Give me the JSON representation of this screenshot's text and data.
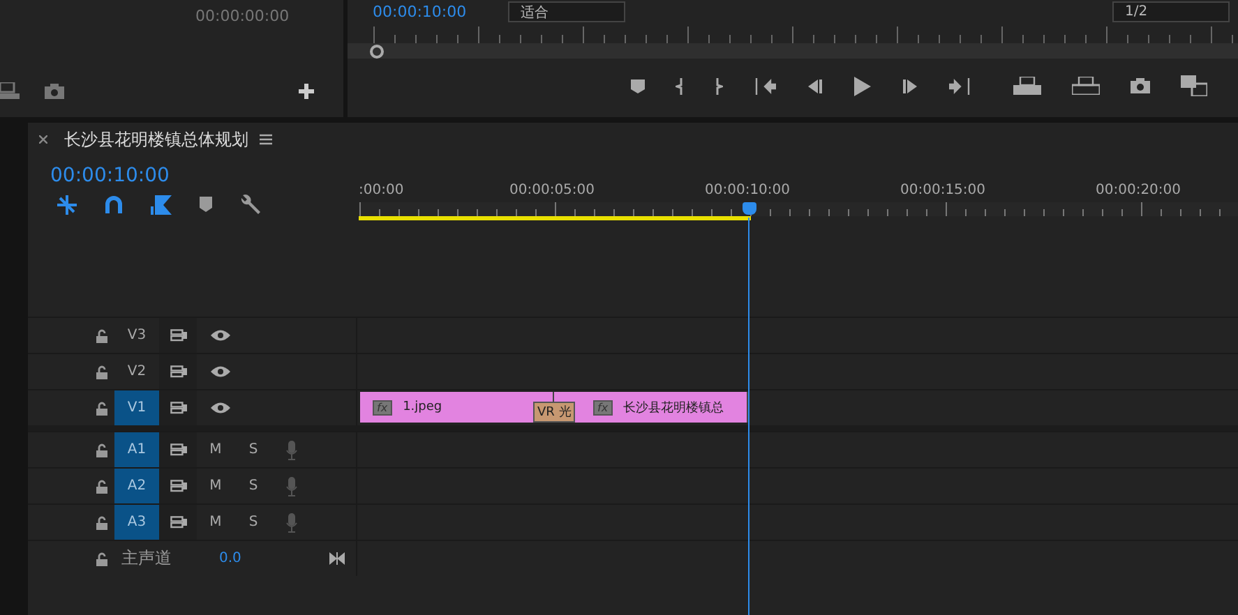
{
  "source_monitor": {
    "timecode": "00:00:00:00"
  },
  "program_monitor": {
    "timecode": "00:00:10:00",
    "fit": "适合",
    "resolution": "1/2"
  },
  "timeline": {
    "title": "长沙县花明楼镇总体规划",
    "timecode": "00:00:10:00",
    "tools": [
      {
        "kind": "ripple",
        "on": true
      },
      {
        "kind": "snap",
        "on": true
      },
      {
        "kind": "linked",
        "on": true
      },
      {
        "kind": "marker",
        "on": false
      },
      {
        "kind": "settings",
        "on": false
      }
    ],
    "ruler_labels": [
      ":00:00",
      "00:00:05:00",
      "00:00:10:00",
      "00:00:15:00",
      "00:00:20:00"
    ],
    "playhead": {
      "level": 0.444
    },
    "video_tracks": [
      {
        "label": "V3",
        "targeted": false
      },
      {
        "label": "V2",
        "targeted": false
      },
      {
        "label": "V1",
        "targeted": true,
        "clips": [
          {
            "kind": "clip",
            "badge": "fx",
            "name": "1.jpeg"
          },
          {
            "kind": "transition",
            "name": "VR 光"
          },
          {
            "kind": "clip",
            "badge": "fx",
            "name": "长沙县花明楼镇总"
          }
        ]
      }
    ],
    "audio_tracks": [
      {
        "label": "A1",
        "targeted": true,
        "mute": "M",
        "solo": "S"
      },
      {
        "label": "A2",
        "targeted": true,
        "mute": "M",
        "solo": "S"
      },
      {
        "label": "A3",
        "targeted": true,
        "mute": "M",
        "solo": "S"
      }
    ],
    "master": {
      "label": "主声道",
      "value": "0.0"
    }
  }
}
